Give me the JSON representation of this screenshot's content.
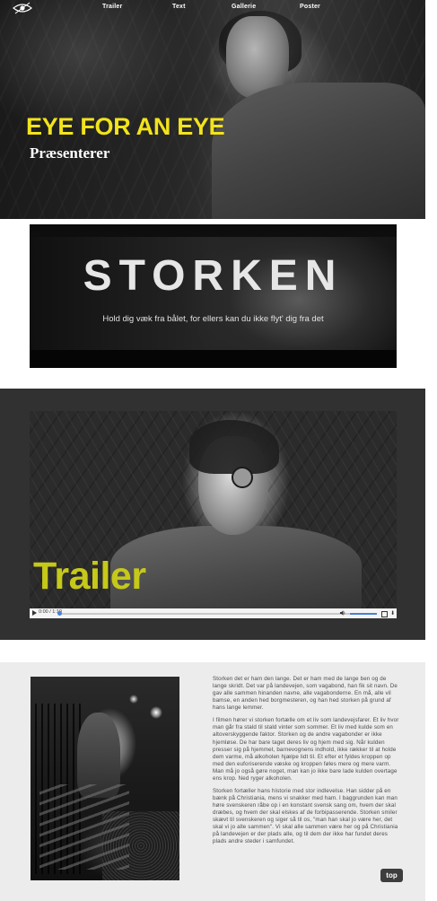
{
  "nav": {
    "items": [
      "Trailer",
      "Text",
      "Gallerie",
      "Poster"
    ]
  },
  "hero": {
    "title": "EYE FOR AN EYE",
    "subtitle": "Præsenterer"
  },
  "banner": {
    "title": "STORKEN",
    "tagline": "Hold dig væk fra bålet, for ellers kan du ikke flyt' dig fra det"
  },
  "trailer": {
    "title": "Trailer",
    "player": {
      "time": "0:00 / 1:19",
      "progress": 0
    }
  },
  "story": {
    "paragraphs": [
      "Storken det er ham den lange. Det er ham med de lange ben og de lange skridt. Det var på landevejen, som vagabond, han fik sit navn. De gav alle sammen hinanden navne, alle vagabonderne. En må, alle vil bamse, en anden hed borgmesteren, og han hed storken på grund af hans lange lemmer.",
      "I filmen hører vi storken fortælle om et liv som landevejsfarer. Et liv hvor man går fra stald til stald vinter som sommer. Et liv med kulde som en altoverskyggende faktor. Storken og de andre vagabonder er ikke hjemløse. De har bare taget deres liv og hjem med sig. Når kulden presser sig på hjemmet, barnevognens indhold, ikke rækker til at holde dem varme, må alkoholen hjælpe lidt til. Et efter et fyldes kroppen op med den euforiserende væske og kroppen føles mere og mere varm. Man må jo også gøre noget, man kan jo ikke bare lade kulden overtage ens krop. Ned ryger alkoholen.",
      "Storken fortæller hans historie med stor indlevelse. Han sidder på en bænk på Christiania, mens vi snakker med ham. I baggrunden kan man høre svenskeren råbe op i en konstant svensk sang om, hvem der skal dræbes, og hvem der skal elskes af de forbipasserende. Storken smiler skævt til svenskeren og siger så til os, \"man han skal jo være her, det skal vi jo alle sammen\". Vi skal alle sammen være her og på Christiania på landevejen er der plads alle, og til dem der ikke har fundet deres plads andre steder i samfundet."
    ]
  },
  "top_button": "top",
  "colors": {
    "hero_title": "#f2e31b",
    "trailer_title": "#c6c81a",
    "trailer_bg": "#313131",
    "story_bg": "#ececec"
  }
}
